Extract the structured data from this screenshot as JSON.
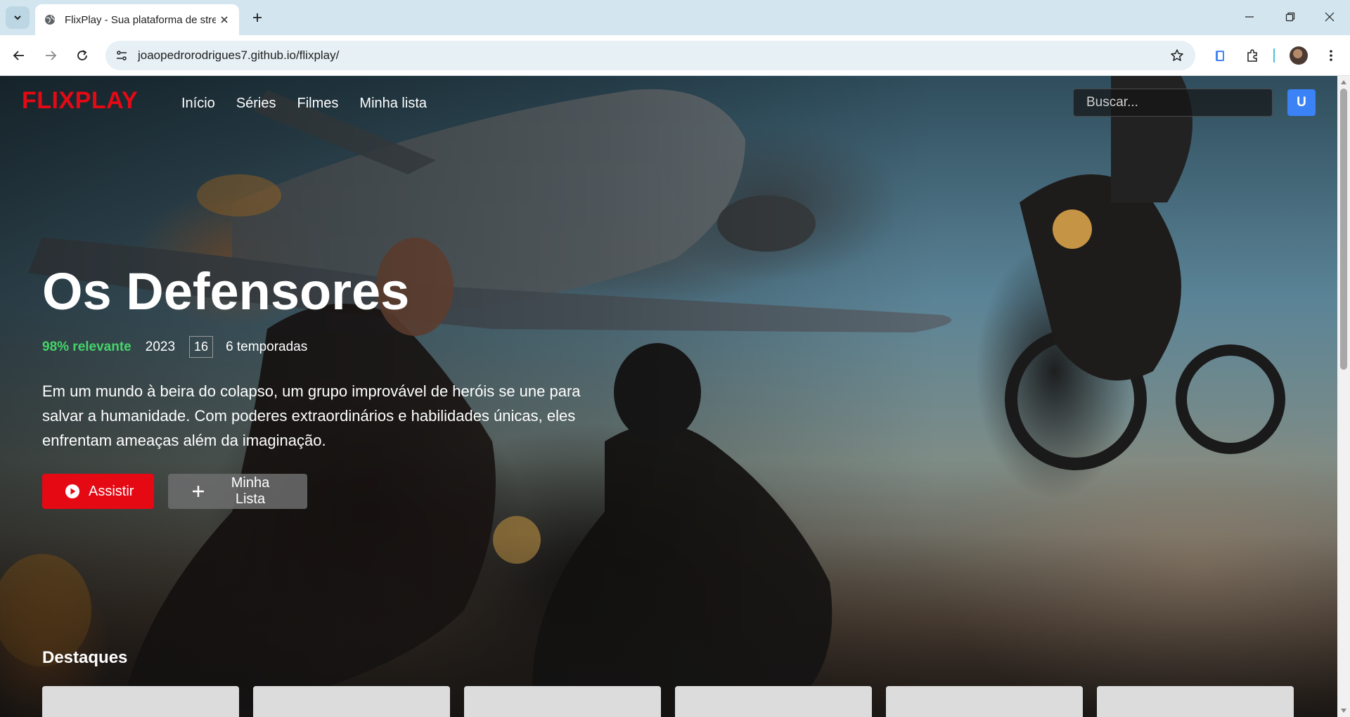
{
  "browser": {
    "tab_title": "FlixPlay - Sua plataforma de streaming",
    "url": "joaopedrorodrigues7.github.io/flixplay/"
  },
  "site": {
    "logo": "FLIXPLAY",
    "nav": [
      "Início",
      "Séries",
      "Filmes",
      "Minha lista"
    ],
    "search_placeholder": "Buscar...",
    "avatar_initial": "U"
  },
  "hero": {
    "title": "Os Defensores",
    "relevance": "98% relevante",
    "year": "2023",
    "age_rating": "16",
    "seasons": "6 temporadas",
    "synopsis": "Em um mundo à beira do colapso, um grupo improvável de heróis se une para salvar a humanidade. Com poderes extraordinários e habilidades únicas, eles enfrentam ameaças além da imaginação.",
    "play_label": "Assistir",
    "list_label": "Minha Lista"
  },
  "featured": {
    "title": "Destaques",
    "card_count": 6
  },
  "colors": {
    "brand": "#e50914",
    "relevance": "#46d369",
    "avatar": "#3b82f6"
  },
  "icons": {
    "play": "play-circle-icon",
    "add": "plus-icon"
  }
}
